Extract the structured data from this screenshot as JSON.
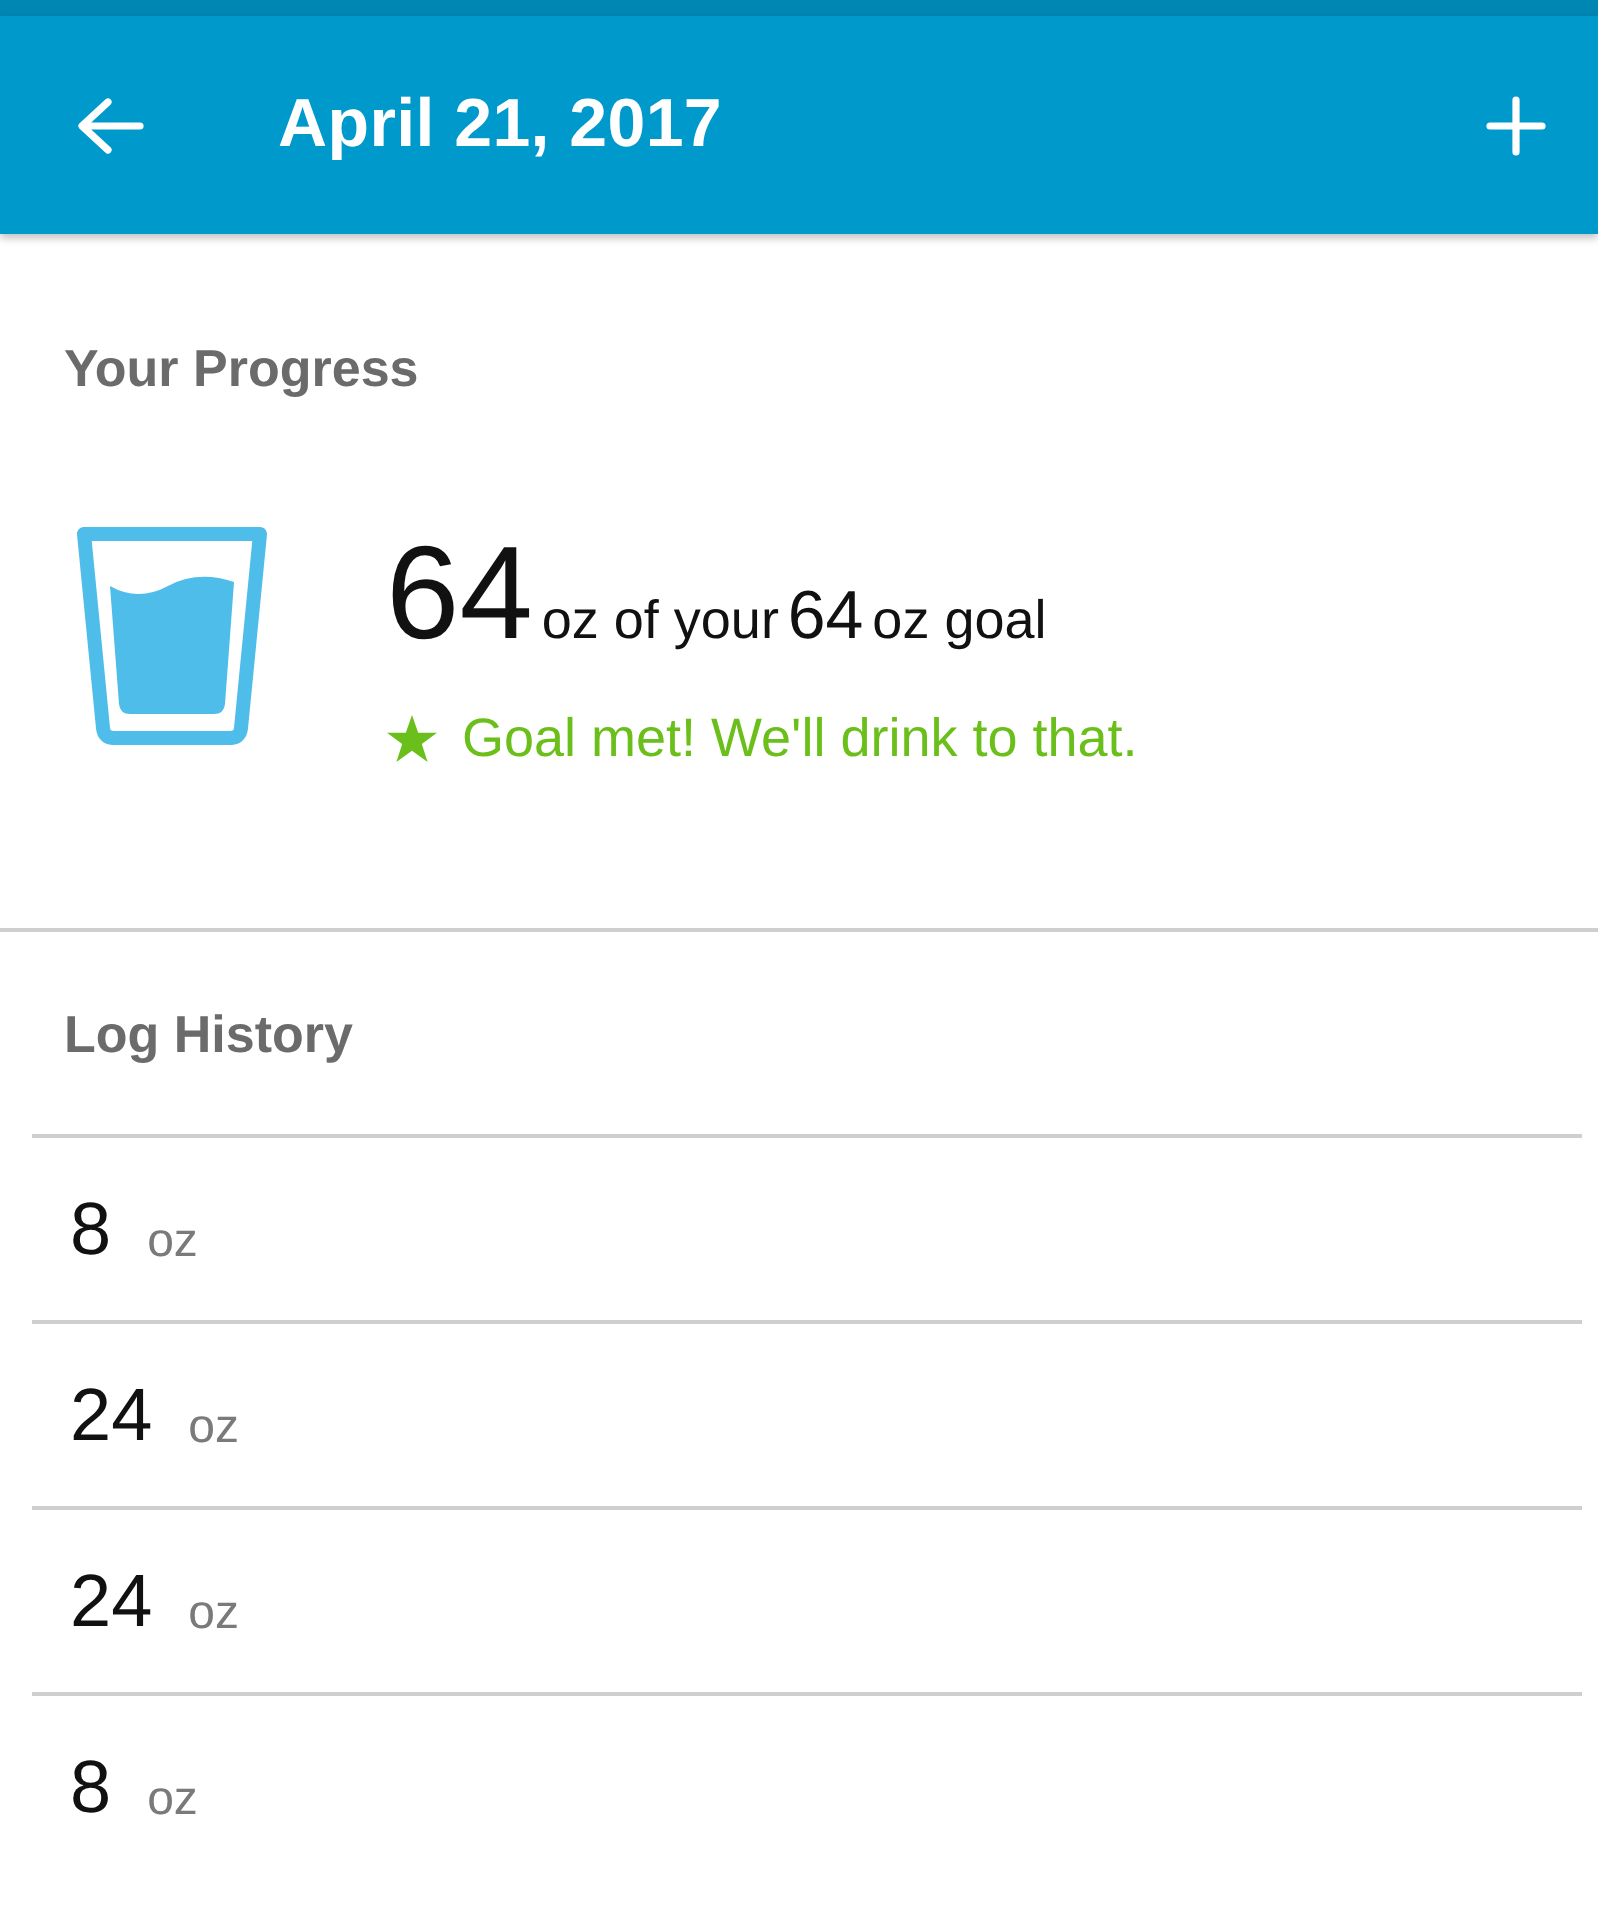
{
  "app_bar": {
    "title": "April 21, 2017"
  },
  "progress": {
    "heading": "Your Progress",
    "amount": "64",
    "amount_text": "oz of your",
    "goal": "64",
    "goal_text": "oz goal",
    "message": "Goal met! We'll drink to that."
  },
  "log_history": {
    "heading": "Log History",
    "entries": [
      {
        "amount": "8",
        "unit": "oz"
      },
      {
        "amount": "24",
        "unit": "oz"
      },
      {
        "amount": "24",
        "unit": "oz"
      },
      {
        "amount": "8",
        "unit": "oz"
      }
    ]
  }
}
